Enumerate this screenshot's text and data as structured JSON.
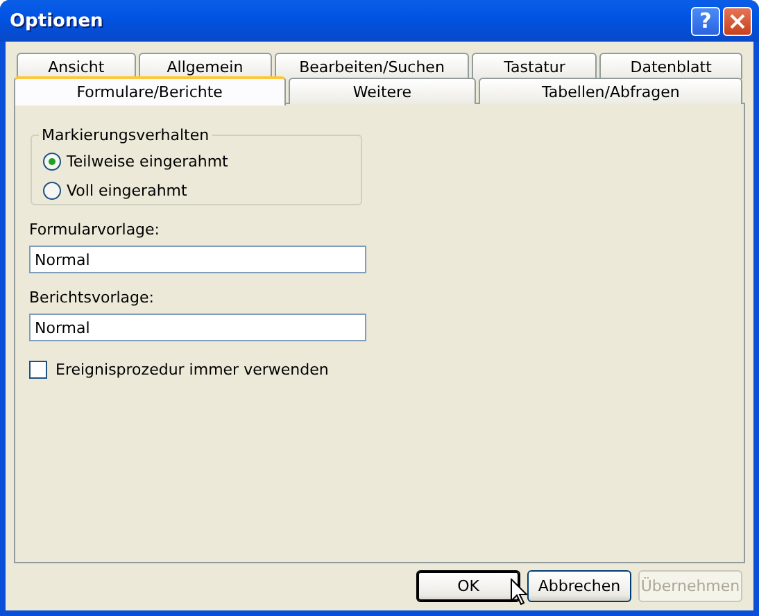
{
  "window": {
    "title": "Optionen",
    "help_button": "?"
  },
  "tab_rows": [
    [
      {
        "label": "Ansicht",
        "selected": false
      },
      {
        "label": "Allgemein",
        "selected": false
      },
      {
        "label": "Bearbeiten/Suchen",
        "selected": false
      },
      {
        "label": "Tastatur",
        "selected": false
      },
      {
        "label": "Datenblatt",
        "selected": false
      }
    ],
    [
      {
        "label": "Formulare/Berichte",
        "selected": true
      },
      {
        "label": "Weitere",
        "selected": false
      },
      {
        "label": "Tabellen/Abfragen",
        "selected": false
      }
    ]
  ],
  "group": {
    "title": "Markierungsverhalten",
    "options": [
      {
        "label": "Teilweise eingerahmt",
        "selected": true
      },
      {
        "label": "Voll eingerahmt",
        "selected": false
      }
    ]
  },
  "fields": [
    {
      "label": "Formularvorlage:",
      "value": "Normal"
    },
    {
      "label": "Berichtsvorlage:",
      "value": "Normal"
    }
  ],
  "checkbox": {
    "label": "Ereignisprozedur immer verwenden",
    "checked": false
  },
  "buttons": [
    {
      "label": "OK",
      "default": true,
      "disabled": false
    },
    {
      "label": "Abbrechen",
      "default": false,
      "disabled": false
    },
    {
      "label": "Übernehmen",
      "default": false,
      "disabled": true
    }
  ]
}
